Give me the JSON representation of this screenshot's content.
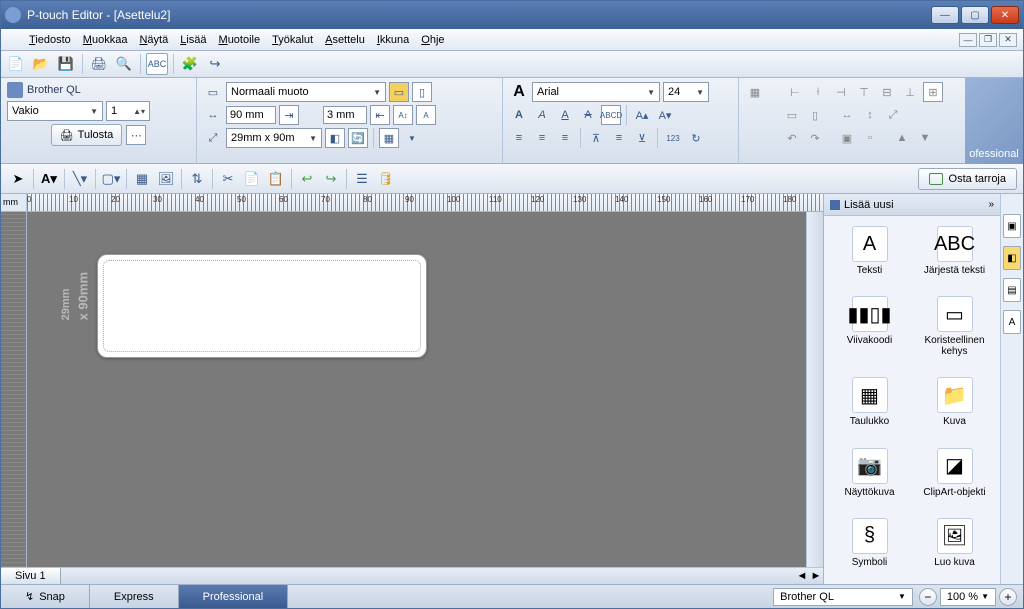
{
  "window": {
    "title": "P-touch Editor - [Asettelu2]"
  },
  "menu": {
    "items": [
      "Tiedosto",
      "Muokkaa",
      "Näytä",
      "Lisää",
      "Muotoile",
      "Työkalut",
      "Asettelu",
      "Ikkuna",
      "Ohje"
    ]
  },
  "printer_panel": {
    "name": "Brother QL",
    "preset": "Vakio",
    "copies": "1",
    "print_btn": "Tulosta"
  },
  "paper_panel": {
    "style": "Normaali muoto",
    "width": "90 mm",
    "margin": "3 mm",
    "size": "29mm x 90m"
  },
  "text_panel": {
    "font": "Arial",
    "size": "24"
  },
  "buy_button": "Osta tarroja",
  "side": {
    "header": "Lisää uusi",
    "items": [
      {
        "label": "Teksti",
        "glyph": "A"
      },
      {
        "label": "Järjestä teksti",
        "glyph": "ABC"
      },
      {
        "label": "Viivakoodi",
        "glyph": "▮▮▯▮"
      },
      {
        "label": "Koristeellinen kehys",
        "glyph": "▭"
      },
      {
        "label": "Taulukko",
        "glyph": "▦"
      },
      {
        "label": "Kuva",
        "glyph": "📁"
      },
      {
        "label": "Näyttökuva",
        "glyph": "📷"
      },
      {
        "label": "ClipArt-objekti",
        "glyph": "◪"
      },
      {
        "label": "Symboli",
        "glyph": "§"
      },
      {
        "label": "Luo kuva",
        "glyph": "🖼"
      }
    ]
  },
  "ruler_unit": "mm",
  "ruler_marks": [
    "0",
    "10",
    "20",
    "30",
    "40",
    "50",
    "60",
    "70",
    "80",
    "90",
    "100",
    "110",
    "120",
    "130",
    "140",
    "150",
    "160",
    "170",
    "180"
  ],
  "label_dim_top": "29mm",
  "label_dim_bot": "x 90mm",
  "page_tab": "Sivu 1",
  "modes": {
    "snap": "Snap",
    "express": "Express",
    "professional": "Professional"
  },
  "status_printer": "Brother QL",
  "zoom": "100 %",
  "brand_corner": "ofessional"
}
